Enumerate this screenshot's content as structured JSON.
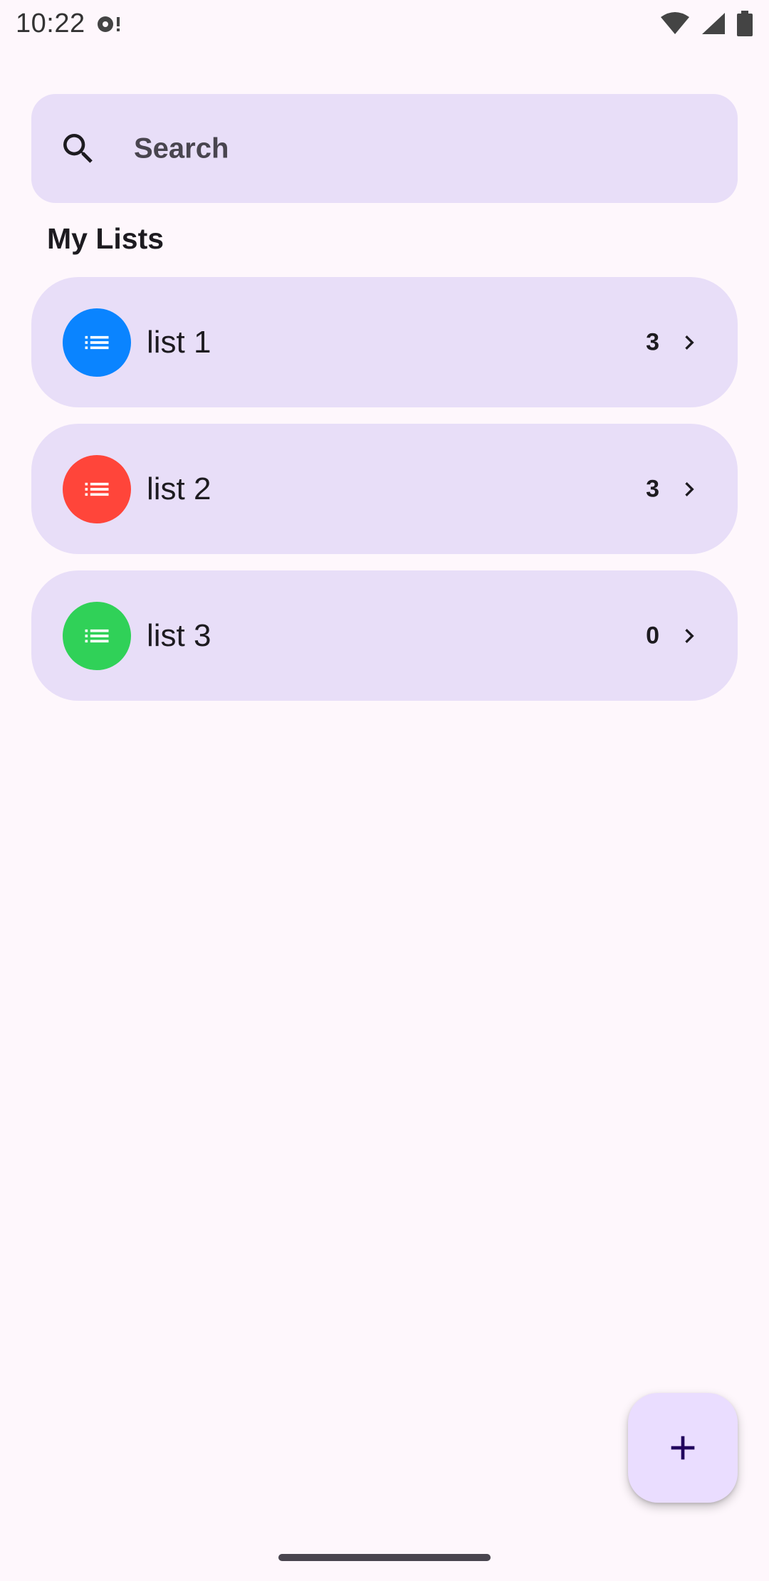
{
  "status_bar": {
    "time": "10:22",
    "icons": [
      "notification-dot-icon",
      "wifi-icon",
      "cellular-signal-icon",
      "battery-icon"
    ]
  },
  "search": {
    "placeholder": "Search",
    "icon": "search-icon"
  },
  "section": {
    "title": "My Lists"
  },
  "lists": [
    {
      "name": "list 1",
      "count": "3",
      "color": "#0A84FF",
      "icon": "list-icon"
    },
    {
      "name": "list 2",
      "count": "3",
      "color": "#FF453A",
      "icon": "list-icon"
    },
    {
      "name": "list 3",
      "count": "0",
      "color": "#30D158",
      "icon": "list-icon"
    }
  ],
  "fab": {
    "icon": "plus-icon"
  },
  "colors": {
    "background": "#FEF7FC",
    "surface": "#E8DEF8",
    "fab": "#EADDFF",
    "on_surface": "#1D1B20"
  }
}
